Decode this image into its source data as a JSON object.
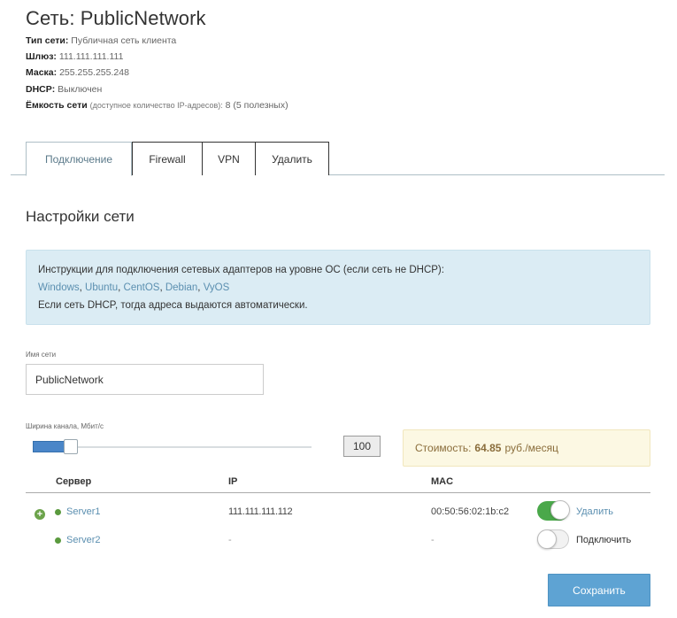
{
  "header": {
    "title": "Сеть: PublicNetwork",
    "meta": {
      "type_label": "Тип сети:",
      "type_value": "Публичная сеть клиента",
      "gateway_label": "Шлюз:",
      "gateway_value": "111.111.111.111",
      "mask_label": "Маска:",
      "mask_value": "255.255.255.248",
      "dhcp_label": "DHCP:",
      "dhcp_value": "Выключен",
      "capacity_label": "Ёмкость сети",
      "capacity_note": "(доступное количество IP-адресов):",
      "capacity_value": "8 (5 полезных)"
    }
  },
  "tabs": [
    {
      "label": "Подключение",
      "active": true
    },
    {
      "label": "Firewall",
      "active": false
    },
    {
      "label": "VPN",
      "active": false
    },
    {
      "label": "Удалить",
      "active": false
    }
  ],
  "settings": {
    "title": "Настройки сети",
    "info": {
      "line1": "Инструкции для подключения сетевых адаптеров на уровне ОС (если сеть не DHCP):",
      "links": [
        "Windows",
        "Ubuntu",
        "CentOS",
        "Debian",
        "VyOS"
      ],
      "separator": ", ",
      "line3": "Если сеть DHCP, тогда адреса выдаются автоматически."
    },
    "name_label": "Имя сети",
    "name_value": "PublicNetwork",
    "bandwidth_label": "Ширина канала, Мбит/с",
    "bandwidth_value": "100",
    "bandwidth_fraction": 0.13,
    "cost_prefix": "Стоимость:",
    "cost_amount": "64.85",
    "cost_suffix": "руб./месяц"
  },
  "table": {
    "headers": {
      "server": "Сервер",
      "ip": "IP",
      "mac": "MAC"
    },
    "rows": [
      {
        "server": "Server1",
        "ip": "111.111.111.112",
        "mac": "00:50:56:02:1b:c2",
        "connected": true,
        "action": "Удалить"
      },
      {
        "server": "Server2",
        "ip": "-",
        "mac": "-",
        "connected": false,
        "action": "Подключить"
      }
    ]
  },
  "save_label": "Сохранить",
  "colors": {
    "accent": "#5ea3d3",
    "link": "#5b8fb0",
    "info_bg": "#dbecf4",
    "cost_bg": "#fcf8e3",
    "status_green": "#5a9a3e",
    "toggle_on": "#4aa84a"
  }
}
